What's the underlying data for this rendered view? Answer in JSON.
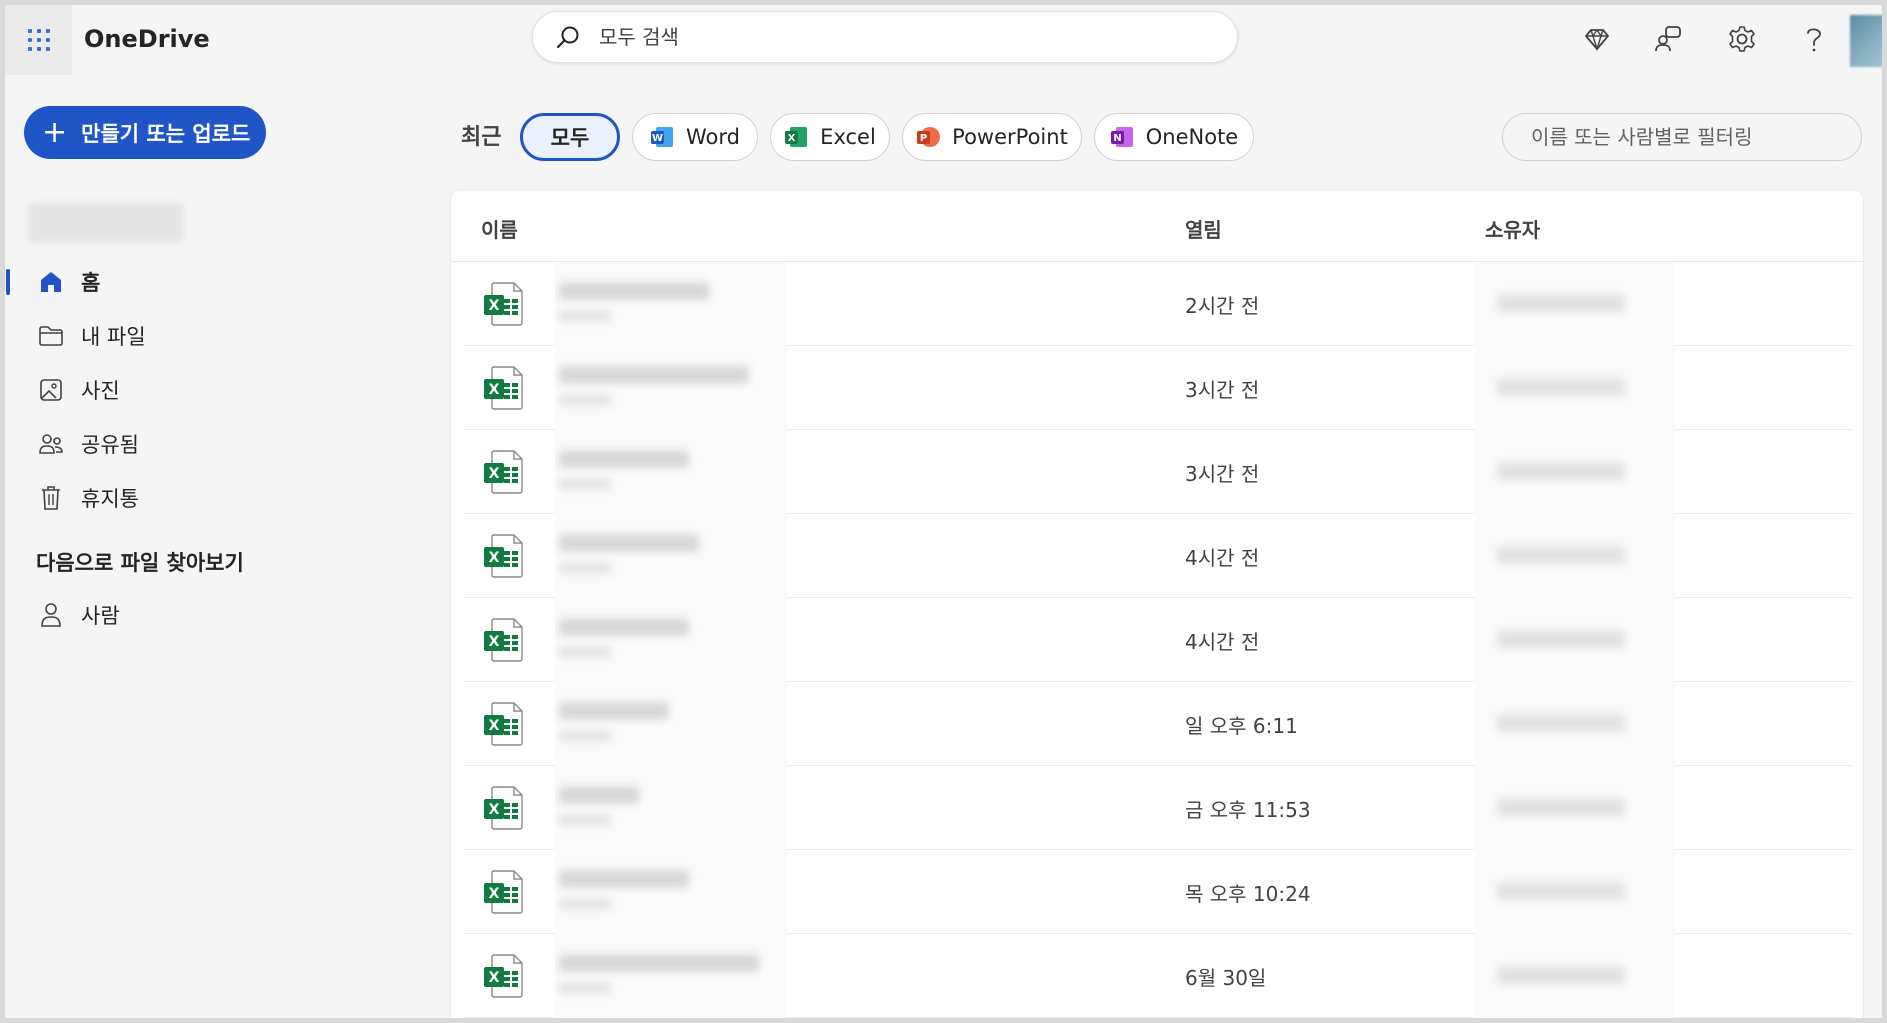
{
  "app": {
    "title": "OneDrive"
  },
  "search": {
    "placeholder": "모두 검색"
  },
  "topbar_icons": [
    "premium-diamond-icon",
    "feedback-icon",
    "settings-gear-icon",
    "help-icon"
  ],
  "sidebar": {
    "create_button": {
      "plus": "+",
      "label": "만들기 또는 업로드"
    },
    "nav": [
      {
        "label": "홈",
        "icon": "home-icon",
        "active": true
      },
      {
        "label": "내 파일",
        "icon": "folder-icon",
        "active": false
      },
      {
        "label": "사진",
        "icon": "photo-icon",
        "active": false
      },
      {
        "label": "공유됨",
        "icon": "people-icon",
        "active": false
      },
      {
        "label": "휴지통",
        "icon": "trash-icon",
        "active": false
      }
    ],
    "browse_heading": "다음으로 파일 찾아보기",
    "browse": [
      {
        "label": "사람",
        "icon": "person-icon"
      }
    ]
  },
  "filters": {
    "recent_label": "최근",
    "pills": [
      {
        "label": "모두",
        "selected": true
      },
      {
        "label": "Word",
        "icon": "word-icon"
      },
      {
        "label": "Excel",
        "icon": "excel-icon"
      },
      {
        "label": "PowerPoint",
        "icon": "powerpoint-icon"
      },
      {
        "label": "OneNote",
        "icon": "onenote-icon"
      }
    ],
    "filter_placeholder": "이름 또는 사람별로 필터링"
  },
  "list": {
    "columns": {
      "name": "이름",
      "opened": "열림",
      "owner": "소유자"
    },
    "rows": [
      {
        "type": "excel",
        "opened": "2시간 전"
      },
      {
        "type": "excel",
        "opened": "3시간 전"
      },
      {
        "type": "excel",
        "opened": "3시간 전"
      },
      {
        "type": "excel",
        "opened": "4시간 전"
      },
      {
        "type": "excel",
        "opened": "4시간 전"
      },
      {
        "type": "excel",
        "opened": "일 오후 6:11"
      },
      {
        "type": "excel",
        "opened": "금 오후 11:53"
      },
      {
        "type": "excel",
        "opened": "목 오후 10:24"
      },
      {
        "type": "excel",
        "opened": "6월 30일"
      }
    ]
  },
  "colors": {
    "accent": "#1f55c7",
    "excel_green": "#107c41",
    "word_blue": "#185abd",
    "powerpoint_red": "#c43e1c",
    "onenote_purple": "#7719aa"
  }
}
